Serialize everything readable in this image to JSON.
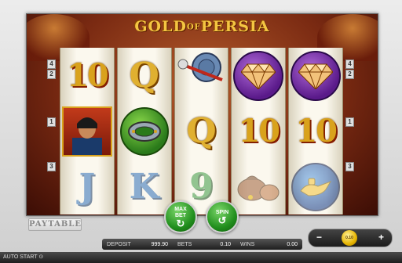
{
  "game": {
    "title_main": "GOLD",
    "title_of": "OF",
    "title_tail": "PERSIA"
  },
  "line_markers": {
    "left": [
      "4",
      "2",
      "1",
      "3"
    ],
    "right": [
      "4",
      "2",
      "1",
      "3"
    ]
  },
  "reels": [
    [
      {
        "type": "ten",
        "text": "10"
      },
      {
        "type": "portrait",
        "text": ""
      },
      {
        "type": "letter",
        "text": "J",
        "color": "blue"
      }
    ],
    [
      {
        "type": "letter",
        "text": "Q",
        "color": "gold"
      },
      {
        "type": "shield",
        "text": ""
      },
      {
        "type": "letter",
        "text": "K",
        "color": "blue"
      }
    ],
    [
      {
        "type": "chakram",
        "text": ""
      },
      {
        "type": "letter",
        "text": "Q",
        "color": "gold"
      },
      {
        "type": "letter",
        "text": "9",
        "color": "green"
      }
    ],
    [
      {
        "type": "diamond",
        "text": ""
      },
      {
        "type": "ten",
        "text": "10"
      },
      {
        "type": "pouch",
        "text": ""
      }
    ],
    [
      {
        "type": "diamond",
        "text": ""
      },
      {
        "type": "ten",
        "text": "10"
      },
      {
        "type": "lamp",
        "text": ""
      }
    ]
  ],
  "buttons": {
    "paytable": "PAYTABLE",
    "max_bet_line1": "MAX",
    "max_bet_line2": "BET",
    "spin": "SPIN"
  },
  "status": {
    "deposit_label": "DEPOSIT",
    "deposit_value": "999.90",
    "bets_label": "BETS",
    "bets_value": "0.10",
    "wins_label": "WINS",
    "wins_value": "0.00"
  },
  "stake": {
    "minus": "−",
    "plus": "+",
    "value": "0.10"
  },
  "footer": {
    "auto_start": "AUTO START ⊙"
  },
  "colors": {
    "reel_bg": "#fbf8ee",
    "accent_gold": "#d9a21c",
    "spin_green": "#22901e"
  }
}
